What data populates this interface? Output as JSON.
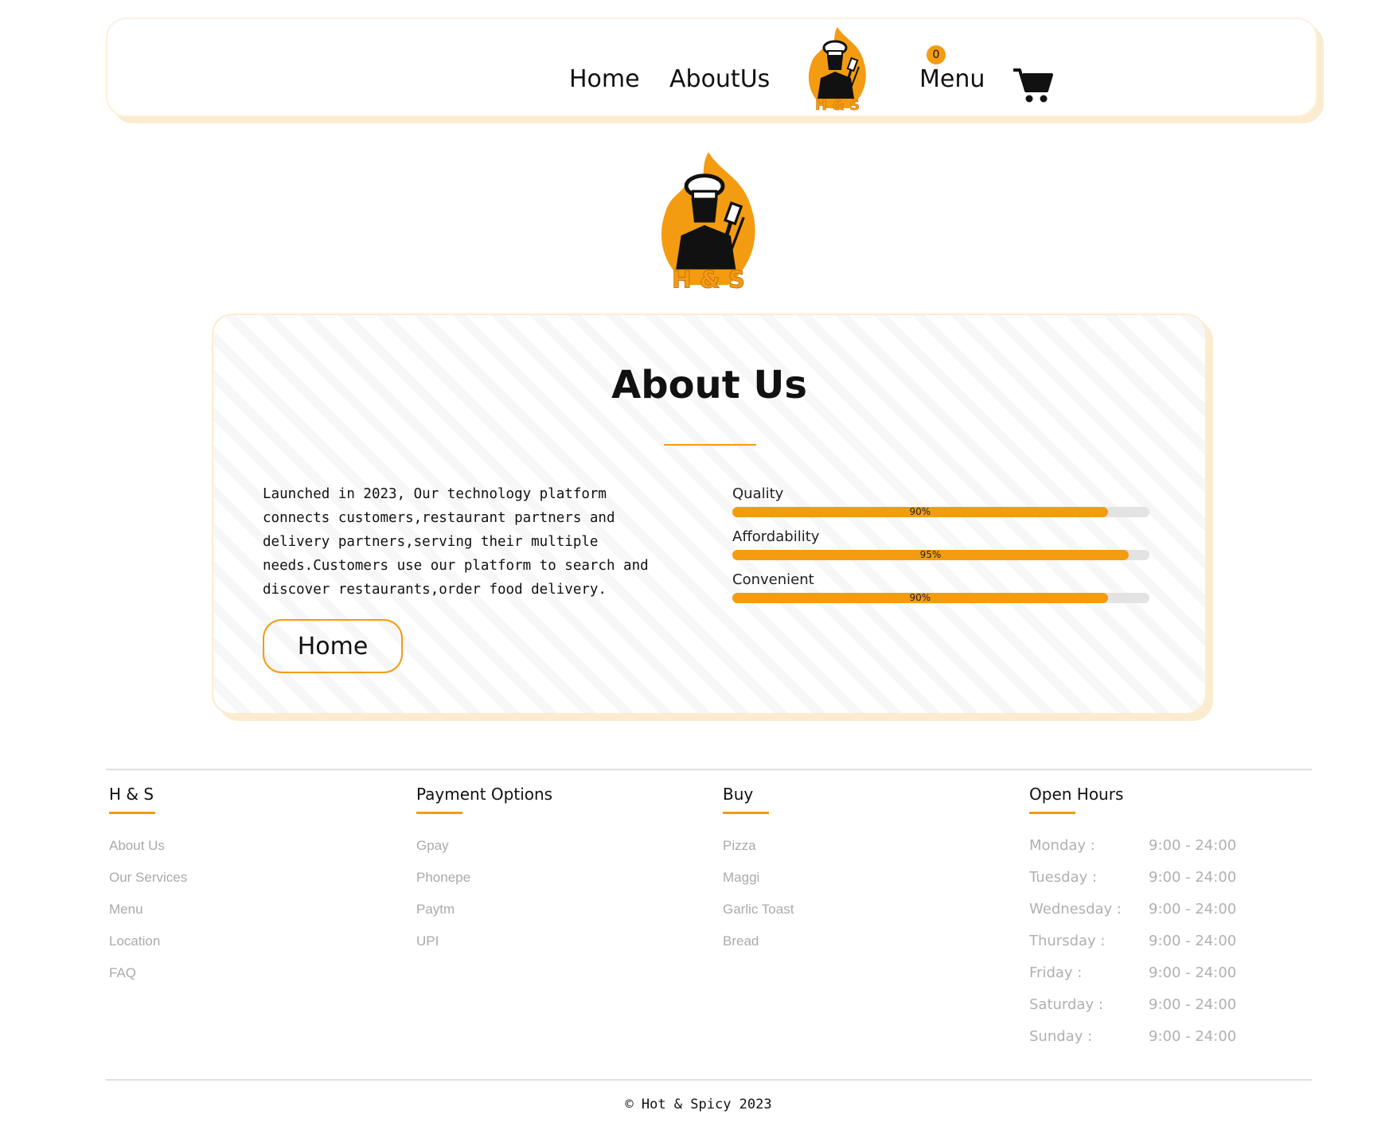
{
  "nav": {
    "home": "Home",
    "about": "AboutUs",
    "menu": "Menu",
    "cart_count": "0",
    "logo_text": "H & S"
  },
  "hero": {
    "logo_text": "H & S"
  },
  "about": {
    "title": "About Us",
    "text": "Launched in 2023, Our technology platform connects customers,restaurant partners and delivery partners,serving their multiple needs.Customers use our platform to search and discover restaurants,order food delivery.",
    "button": "Home",
    "skills": [
      {
        "label": "Quality",
        "percent": 90,
        "percent_label": "90%"
      },
      {
        "label": "Affordability",
        "percent": 95,
        "percent_label": "95%"
      },
      {
        "label": "Convenient",
        "percent": 90,
        "percent_label": "90%"
      }
    ]
  },
  "footer": {
    "col1": {
      "heading": "H & S",
      "items": [
        "About Us",
        "Our Services",
        "Menu",
        "Location",
        "FAQ"
      ]
    },
    "col2": {
      "heading": "Payment Options",
      "items": [
        "Gpay",
        "Phonepe",
        "Paytm",
        "UPI"
      ]
    },
    "col3": {
      "heading": "Buy",
      "items": [
        "Pizza",
        "Maggi",
        "Garlic Toast",
        "Bread"
      ]
    },
    "col4": {
      "heading": "Open Hours",
      "rows": [
        {
          "day": "Monday :",
          "time": "9:00 - 24:00"
        },
        {
          "day": "Tuesday :",
          "time": "9:00 - 24:00"
        },
        {
          "day": "Wednesday :",
          "time": "9:00 - 24:00"
        },
        {
          "day": "Thursday :",
          "time": "9:00 - 24:00"
        },
        {
          "day": "Friday :",
          "time": "9:00 - 24:00"
        },
        {
          "day": "Saturday :",
          "time": "9:00 - 24:00"
        },
        {
          "day": "Sunday :",
          "time": "9:00 - 24:00"
        }
      ]
    },
    "copyright": "© Hot & Spicy 2023"
  },
  "colors": {
    "accent": "#f39c12",
    "card_border": "#fbecd0",
    "muted_text": "#aaaaaa"
  }
}
